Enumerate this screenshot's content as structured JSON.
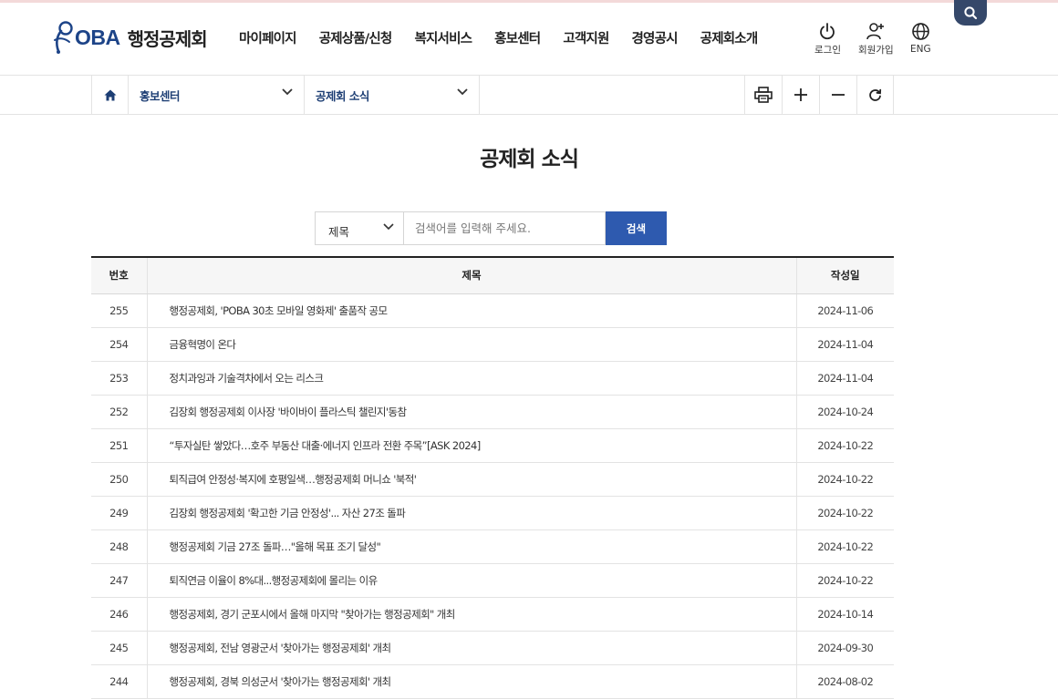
{
  "header": {
    "logo_en": "OBA",
    "logo_ko": "행정공제회",
    "nav": [
      "마이페이지",
      "공제상품/신청",
      "복지서비스",
      "홍보센터",
      "고객지원",
      "경영공시",
      "공제회소개"
    ],
    "util": {
      "login": "로그인",
      "join": "회원가입",
      "lang": "ENG"
    }
  },
  "subnav": {
    "depth1": "홍보센터",
    "depth2": "공제회 소식"
  },
  "page_title": "공제회 소식",
  "search": {
    "select_value": "제목",
    "placeholder": "검색어를 입력해 주세요.",
    "button": "검색"
  },
  "table": {
    "headers": [
      "번호",
      "제목",
      "작성일"
    ],
    "rows": [
      {
        "num": "255",
        "title": "행정공제회, 'POBA 30초 모바일 영화제' 출품작 공모",
        "date": "2024-11-06"
      },
      {
        "num": "254",
        "title": "금융혁명이 온다",
        "date": "2024-11-04"
      },
      {
        "num": "253",
        "title": "정치과잉과 기술격차에서 오는 리스크",
        "date": "2024-11-04"
      },
      {
        "num": "252",
        "title": "김장회 행정공제회 이사장 '바이바이 플라스틱 챌린지'동참",
        "date": "2024-10-24"
      },
      {
        "num": "251",
        "title": "“투자실탄 쌓았다…호주 부동산 대출·에너지 인프라 전환 주목”[ASK 2024]",
        "date": "2024-10-22"
      },
      {
        "num": "250",
        "title": "퇴직급여 안정성·복지에 호평일색…행정공제회 머니쇼 '북적'",
        "date": "2024-10-22"
      },
      {
        "num": "249",
        "title": "김장회 행정공제회 '확고한 기금 안정성'... 자산 27조 돌파",
        "date": "2024-10-22"
      },
      {
        "num": "248",
        "title": "행정공제회 기금 27조 돌파…\"올해 목표 조기 달성\"",
        "date": "2024-10-22"
      },
      {
        "num": "247",
        "title": "퇴직연금 이율이 8%대...행정공제회에 몰리는 이유",
        "date": "2024-10-22"
      },
      {
        "num": "246",
        "title": "행정공제회, 경기 군포시에서 올해 마지막 \"찾아가는 행정공제회\" 개최",
        "date": "2024-10-14"
      },
      {
        "num": "245",
        "title": "행정공제회, 전남 영광군서 '찾아가는 행정공제회' 개최",
        "date": "2024-09-30"
      },
      {
        "num": "244",
        "title": "행정공제회, 경북 의성군서 '찾아가는 행정공제회' 개최",
        "date": "2024-08-02"
      }
    ]
  },
  "colors": {
    "brand_navy": "#1d4488",
    "button_blue": "#2e5aaf",
    "search_tab": "#35486a"
  }
}
